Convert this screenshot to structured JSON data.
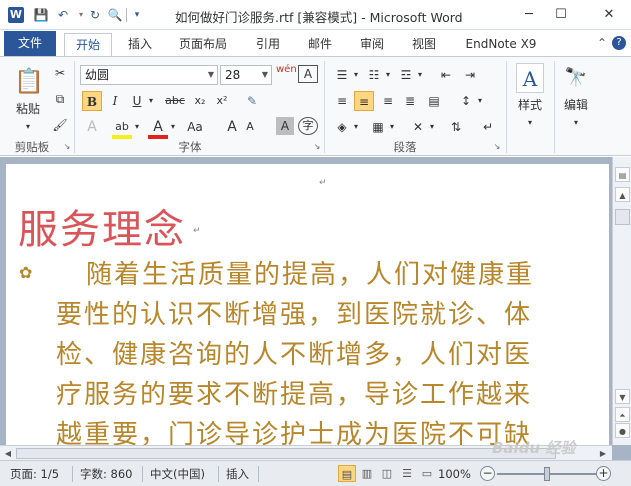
{
  "titlebar": {
    "app_icon": "W",
    "title": "如何做好门诊服务.rtf [兼容模式] - Microsoft Word",
    "qat_icons": [
      "save-icon",
      "undo-icon",
      "redo-icon",
      "print-preview-icon",
      "customize-qat-icon"
    ],
    "minimize": "─",
    "maximize": "☐",
    "close": "✕"
  },
  "tabs": {
    "file": "文件",
    "items": [
      "开始",
      "插入",
      "页面布局",
      "引用",
      "邮件",
      "审阅",
      "视图",
      "EndNote X9"
    ],
    "active_index": 0,
    "right_icons": [
      "minimize-ribbon-icon",
      "help-icon"
    ]
  },
  "ribbon": {
    "clipboard": {
      "paste_label": "粘贴",
      "group_label": "剪贴板"
    },
    "font": {
      "font_name": "幼圆",
      "font_size": "28",
      "group_label": "字体",
      "bold": "B",
      "italic": "I",
      "underline": "U",
      "strikethrough": "abc",
      "subscript": "x₂",
      "superscript": "x²",
      "grow": "A",
      "shrink": "A",
      "change_case": "Aa",
      "highlight_icon": "ab",
      "font_color": "A",
      "phonetic": "wén",
      "char_border": "A",
      "char_shading": "A",
      "enclose": "字"
    },
    "paragraph": {
      "group_label": "段落"
    },
    "styles": {
      "label": "样式"
    },
    "editing": {
      "label": "编辑"
    }
  },
  "document": {
    "heading": "服务理念",
    "body_lines": [
      "随着生活质量的提高，人们对健康重",
      "要性的认识不断增强，到医院就诊、体",
      "检、健康咨询的人不断增多，人们对医",
      "疗服务的要求不断提高，导诊工作越来",
      "越重要，门诊导诊护士成为医院不可缺"
    ],
    "paragraph_mark": "↵"
  },
  "statusbar": {
    "page": "页面: 1/5",
    "words": "字数: 860",
    "language": "中文(中国)",
    "mode": "插入",
    "zoom": "100%",
    "zoom_value": 100,
    "zoom_minus": "−",
    "zoom_plus": "+"
  },
  "watermark": "Baidu 经验",
  "colors": {
    "heading": "#d9555a",
    "body_text": "#b8862b",
    "file_tab": "#2b579a"
  }
}
